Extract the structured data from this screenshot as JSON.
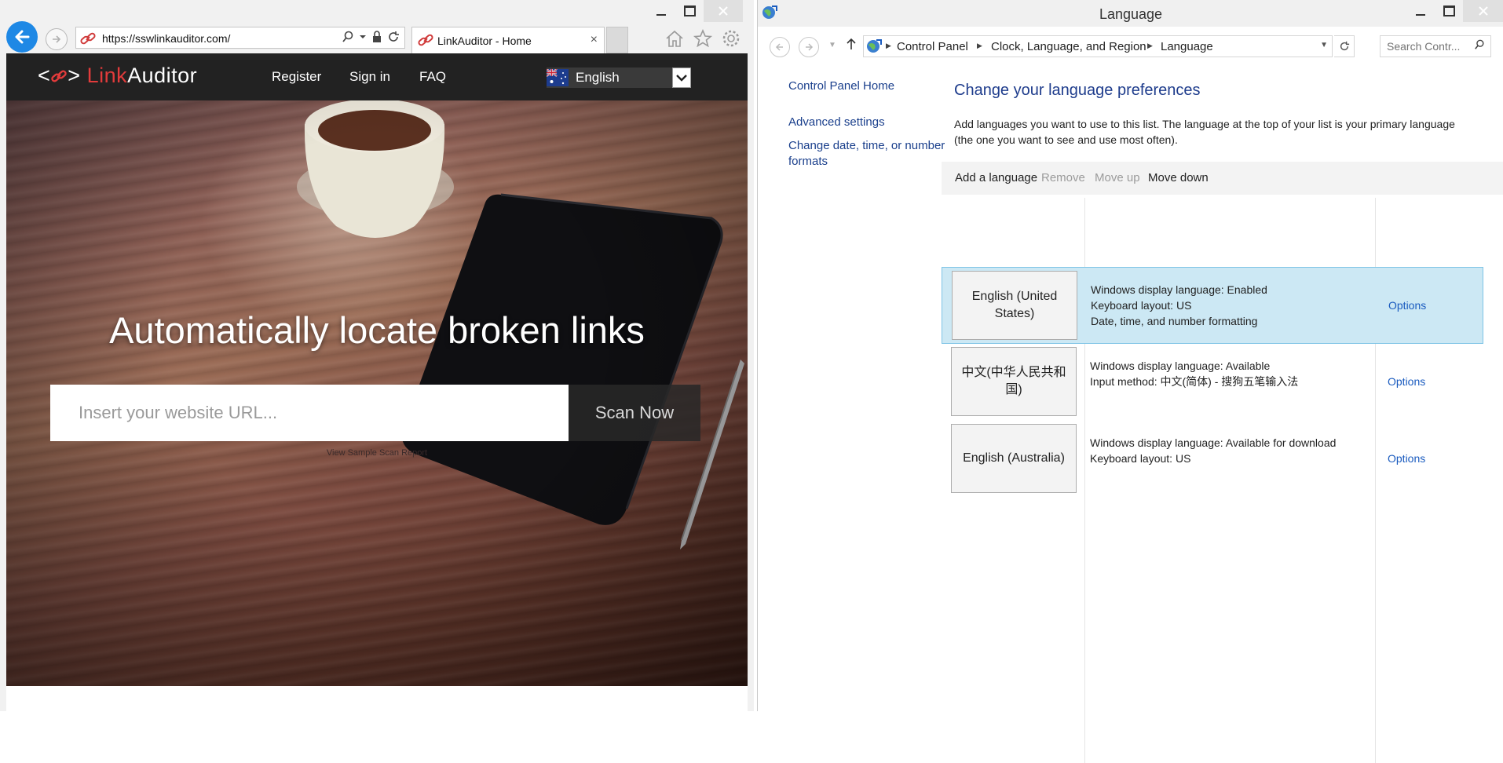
{
  "ie": {
    "address_url": "https://sswlinkauditor.com/",
    "tab_title": "LinkAuditor - Home",
    "tab_close": "×"
  },
  "site": {
    "logo_link": "Link",
    "logo_rest": "Auditor",
    "logo_brackets_left": "<",
    "logo_brackets_right": ">",
    "nav": {
      "register": "Register",
      "signin": "Sign in",
      "faq": "FAQ"
    },
    "language_selected": "English",
    "hero_title": "Automatically locate broken links",
    "url_placeholder": "Insert your website URL...",
    "scan_button": "Scan Now",
    "sample_link": "View Sample Scan Report",
    "colors": {
      "nav_bg": "#222222",
      "accent": "#e23b3b"
    }
  },
  "cp": {
    "window_title": "Language",
    "breadcrumb": [
      "Control Panel",
      "Clock, Language, and Region",
      "Language"
    ],
    "search_placeholder": "Search Contr...",
    "left_links": {
      "home": "Control Panel Home",
      "advanced": "Advanced settings",
      "date_formats": "Change date, time, or number formats"
    },
    "heading": "Change your language preferences",
    "description": "Add languages you want to use to this list. The language at the top of your list is your primary language (the one you want to see and use most often).",
    "toolbar": {
      "add": "Add a language",
      "remove": "Remove",
      "move_up": "Move up",
      "move_down": "Move down"
    },
    "languages": [
      {
        "name": "English (United States)",
        "line1": "Windows display language: Enabled",
        "line2": "Keyboard layout: US",
        "line3": "Date, time, and number formatting",
        "options": "Options",
        "selected": true
      },
      {
        "name": "中文(中华人民共和国)",
        "line1": "Windows display language: Available",
        "line2": "Input method: 中文(简体) - 搜狗五笔输入法",
        "line3": "",
        "options": "Options",
        "selected": false
      },
      {
        "name": "English (Australia)",
        "line1": "Windows display language: Available for download",
        "line2": "Keyboard layout: US",
        "line3": "",
        "options": "Options",
        "selected": false
      }
    ]
  }
}
